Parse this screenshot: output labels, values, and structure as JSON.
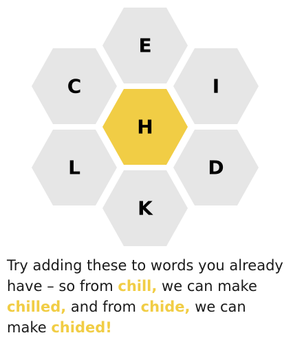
{
  "puzzle": {
    "center_letter": "H",
    "outer_letters": {
      "top": "E",
      "upper_left": "C",
      "upper_right": "I",
      "lower_left": "L",
      "lower_right": "D",
      "bottom": "K"
    }
  },
  "tip": {
    "part1": "Try adding these to words you already have – so from ",
    "word1": "chill,",
    "part2": " we can make ",
    "word2": "chilled,",
    "part3": " and from ",
    "word3": "chide,",
    "part4": " we can make ",
    "word4": "chided!"
  },
  "colors": {
    "center_cell": "#f1cd45",
    "outer_cell": "#e6e6e6",
    "highlight_text": "#f1cd45"
  }
}
